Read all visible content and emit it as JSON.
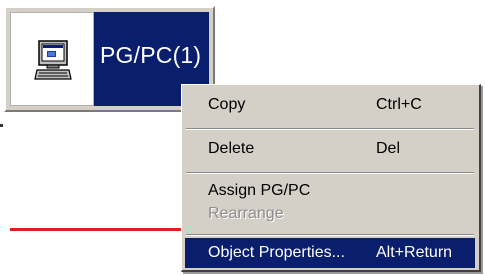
{
  "node": {
    "title": "PG/PC(1)",
    "icon": "computer-monitor-icon"
  },
  "menu": {
    "items": [
      {
        "label": "Copy",
        "shortcut": "Ctrl+C",
        "disabled": false,
        "active": false
      },
      {
        "label": "Delete",
        "shortcut": "Del",
        "disabled": false,
        "active": false
      },
      {
        "label": "Assign PG/PC",
        "shortcut": "",
        "disabled": false,
        "active": false
      },
      {
        "label": "Rearrange",
        "shortcut": "",
        "disabled": true,
        "active": false
      },
      {
        "label": "Object Properties...",
        "shortcut": "Alt+Return",
        "disabled": false,
        "active": true
      }
    ]
  },
  "colors": {
    "selection": "#0a1e6e",
    "menu_bg": "#d4d0c8",
    "connection_line": "#e02020"
  }
}
